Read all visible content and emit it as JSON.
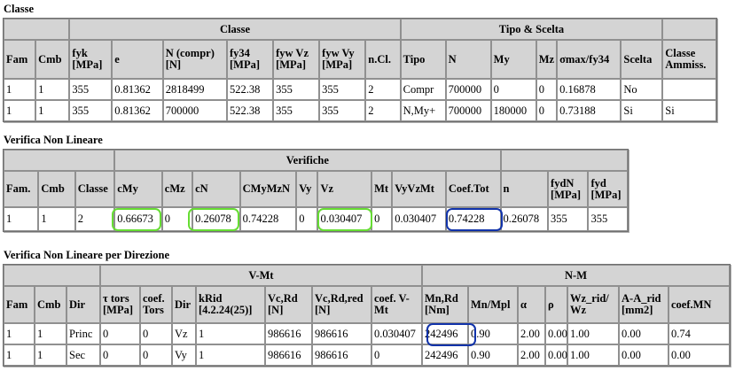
{
  "t1": {
    "title": "Classe",
    "group_left": "",
    "group_classe": "Classe",
    "group_tipo": "Tipo & Scelta",
    "group_right": "",
    "headers": [
      "Fam",
      "Cmb",
      "fyk [MPa]",
      "e",
      "N (compr) [N]",
      "fy34 [MPa]",
      "fyw Vz [MPa]",
      "fyw Vy [MPa]",
      "n.Cl.",
      "Tipo",
      "N",
      "My",
      "Mz",
      "σmax/fy34",
      "Scelta",
      "Classe Ammiss."
    ],
    "rows": [
      [
        "1",
        "1",
        "355",
        "0.81362",
        "2818499",
        "522.38",
        "355",
        "355",
        "2",
        "Compr",
        "700000",
        "0",
        "0",
        "0.16878",
        "No",
        ""
      ],
      [
        "1",
        "1",
        "355",
        "0.81362",
        "700000",
        "522.38",
        "355",
        "355",
        "2",
        "N,My+",
        "700000",
        "180000",
        "0",
        "0.73188",
        "Si",
        "Si"
      ]
    ]
  },
  "t2": {
    "title": "Verifica Non Lineare",
    "group_verifiche": "Verifiche",
    "headers": [
      "Fam.",
      "Cmb",
      "Classe",
      "cMy",
      "cMz",
      "cN",
      "CMyMzN",
      "Vy",
      "Vz",
      "Mt",
      "VyVzMt",
      "Coef.Tot",
      "n",
      "fydN [MPa]",
      "fyd [MPa]"
    ],
    "rows": [
      [
        "1",
        "1",
        "2",
        "0.66673",
        "0",
        "0.26078",
        "0.74228",
        "0",
        "0.030407",
        "0",
        "0.030407",
        "0.74228",
        "0.26078",
        "355",
        "355"
      ]
    ]
  },
  "t3": {
    "title": "Verifica Non Lineare per Direzione",
    "group_vmt": "V-Mt",
    "group_nm": "N-M",
    "headers": [
      "Fam",
      "Cmb",
      "Dir",
      "τ tors [MPa]",
      "coef. Tors",
      "Dir",
      "kRid [4.2.24(25)]",
      "Vc,Rd [N]",
      "Vc,Rd,red [N]",
      "coef. V-Mt",
      "Mn,Rd [Nm]",
      "Mn/Mpl",
      "α",
      "ρ",
      "Wz_rid/ Wz",
      "A-A_rid [mm2]",
      "coef.MN"
    ],
    "rows": [
      [
        "1",
        "1",
        "Princ",
        "0",
        "0",
        "Vz",
        "1",
        "986616",
        "986616",
        "0.030407",
        "242496",
        "0.90",
        "2.00",
        "0.00",
        "1.00",
        "0.00",
        "0.74"
      ],
      [
        "1",
        "1",
        "Sec",
        "0",
        "0",
        "Vy",
        "1",
        "986616",
        "986616",
        "0",
        "242496",
        "0.90",
        "2.00",
        "0.00",
        "1.00",
        "0.00",
        "0.00"
      ]
    ]
  }
}
